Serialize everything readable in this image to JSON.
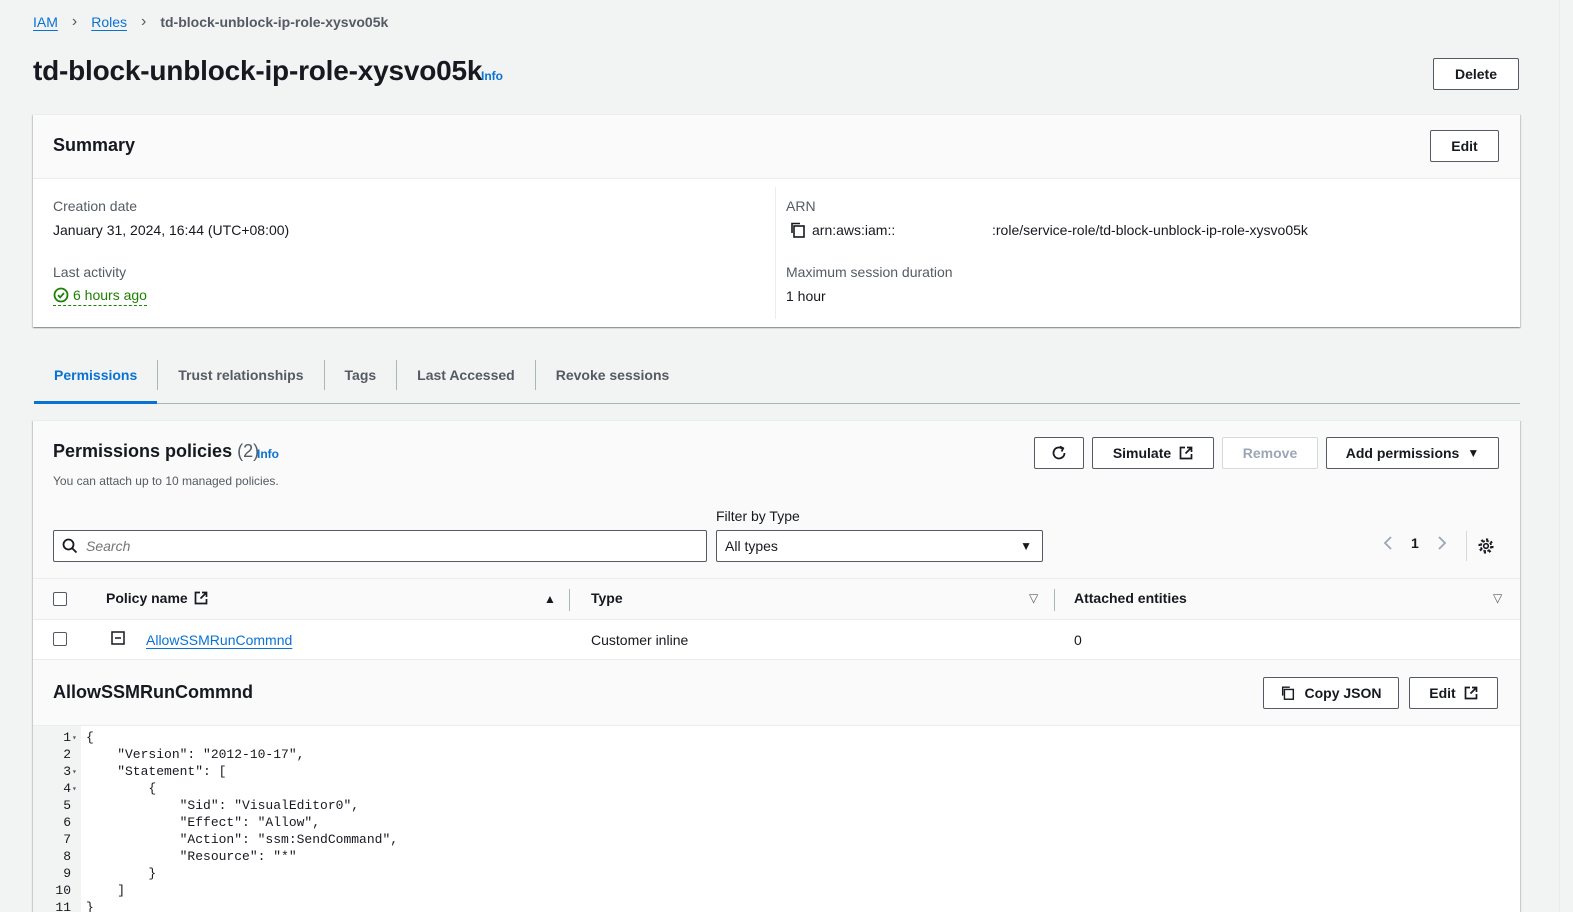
{
  "breadcrumb": {
    "items": [
      {
        "label": "IAM"
      },
      {
        "label": "Roles"
      }
    ],
    "current": "td-block-unblock-ip-role-xysvo05k"
  },
  "page": {
    "title": "td-block-unblock-ip-role-xysvo05k",
    "info": "Info",
    "delete_label": "Delete"
  },
  "summary": {
    "title": "Summary",
    "edit_label": "Edit",
    "creation_date_label": "Creation date",
    "creation_date_value": "January 31, 2024, 16:44 (UTC+08:00)",
    "last_activity_label": "Last activity",
    "last_activity_value": "6 hours ago",
    "arn_label": "ARN",
    "arn_prefix": "arn:aws:iam::",
    "arn_suffix": ":role/service-role/td-block-unblock-ip-role-xysvo05k",
    "max_session_label": "Maximum session duration",
    "max_session_value": "1 hour"
  },
  "tabs": [
    {
      "label": "Permissions",
      "active": true
    },
    {
      "label": "Trust relationships"
    },
    {
      "label": "Tags"
    },
    {
      "label": "Last Accessed"
    },
    {
      "label": "Revoke sessions"
    }
  ],
  "permissions": {
    "title": "Permissions policies",
    "count": "(2)",
    "info": "Info",
    "description": "You can attach up to 10 managed policies.",
    "simulate_label": "Simulate",
    "remove_label": "Remove",
    "add_permissions_label": "Add permissions",
    "filter_label": "Filter by Type",
    "search_placeholder": "Search",
    "filter_value": "All types",
    "page_number": "1",
    "columns": {
      "policy_name": "Policy name",
      "type": "Type",
      "attached": "Attached entities"
    },
    "rows": [
      {
        "name": "AllowSSMRunCommnd",
        "type": "Customer inline",
        "attached": "0"
      }
    ]
  },
  "detail": {
    "title": "AllowSSMRunCommnd",
    "copy_json_label": "Copy JSON",
    "edit_label": "Edit",
    "lines": [
      {
        "n": "1",
        "text": "{"
      },
      {
        "n": "2",
        "text": "    \"Version\": \"2012-10-17\","
      },
      {
        "n": "3",
        "text": "    \"Statement\": ["
      },
      {
        "n": "4",
        "text": "        {"
      },
      {
        "n": "5",
        "text": "            \"Sid\": \"VisualEditor0\","
      },
      {
        "n": "6",
        "text": "            \"Effect\": \"Allow\","
      },
      {
        "n": "7",
        "text": "            \"Action\": \"ssm:SendCommand\","
      },
      {
        "n": "8",
        "text": "            \"Resource\": \"*\""
      },
      {
        "n": "9",
        "text": "        }"
      },
      {
        "n": "10",
        "text": "    ]"
      },
      {
        "n": "11",
        "text": "}"
      }
    ]
  },
  "colors": {
    "link": "#0972d3",
    "success": "#1d8102",
    "border": "#545b64"
  }
}
